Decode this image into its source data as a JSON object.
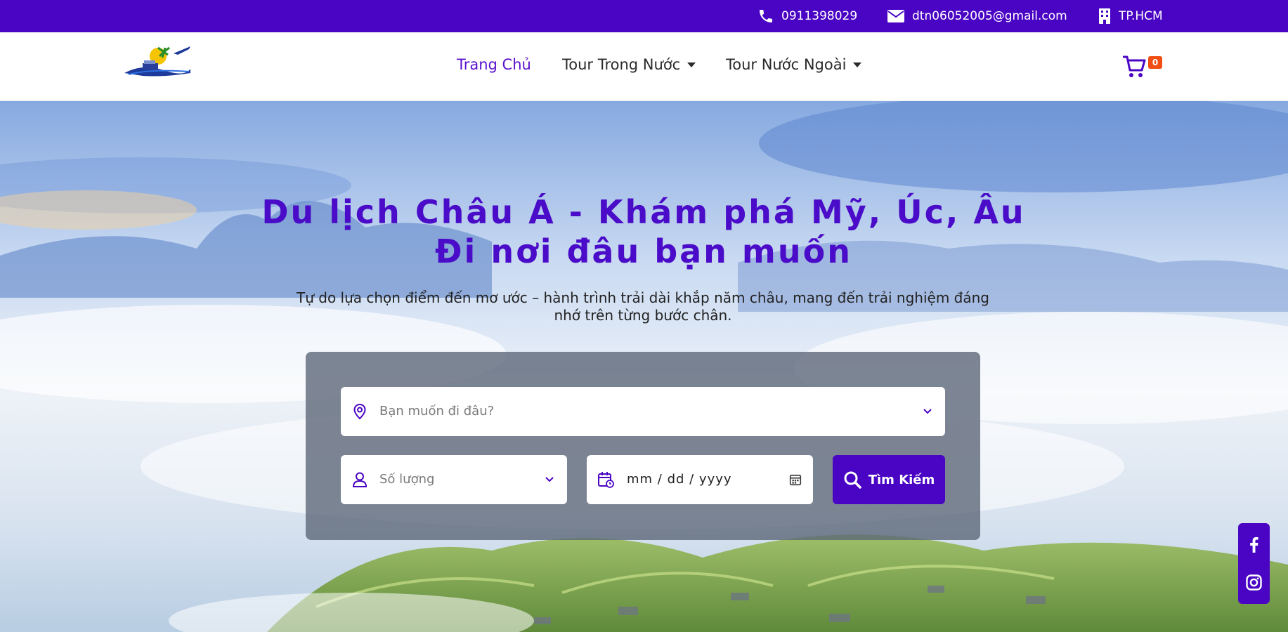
{
  "topbar": {
    "phone": "0911398029",
    "email": "dtn06052005@gmail.com",
    "location": "TP.HCM"
  },
  "nav": {
    "home": "Trang Chủ",
    "domestic": "Tour Trong Nước",
    "international": "Tour Nước Ngoài",
    "cart_count": "0"
  },
  "hero": {
    "title_line1": "Du lịch Châu Á - Khám phá Mỹ, Úc, Âu",
    "title_line2": "Đi nơi đâu bạn muốn",
    "subtitle": "Tự do lựa chọn điểm đến mơ ước – hành trình trải dài khắp năm châu, mang đến trải nghiệm đáng nhớ trên từng bước chân."
  },
  "search": {
    "destination_placeholder": "Bạn muốn đi đâu?",
    "quantity_placeholder": "Số lượng",
    "date_placeholder": "mm / dd / yyyy",
    "button_label": "Tìm Kiếm"
  },
  "colors": {
    "brand": "#4a05c4",
    "badge": "#f04e12"
  },
  "icons": [
    "phone-icon",
    "mail-icon",
    "building-icon",
    "cart-icon",
    "map-pin-icon",
    "user-icon",
    "calendar-icon",
    "search-icon",
    "facebook-icon",
    "instagram-icon"
  ]
}
